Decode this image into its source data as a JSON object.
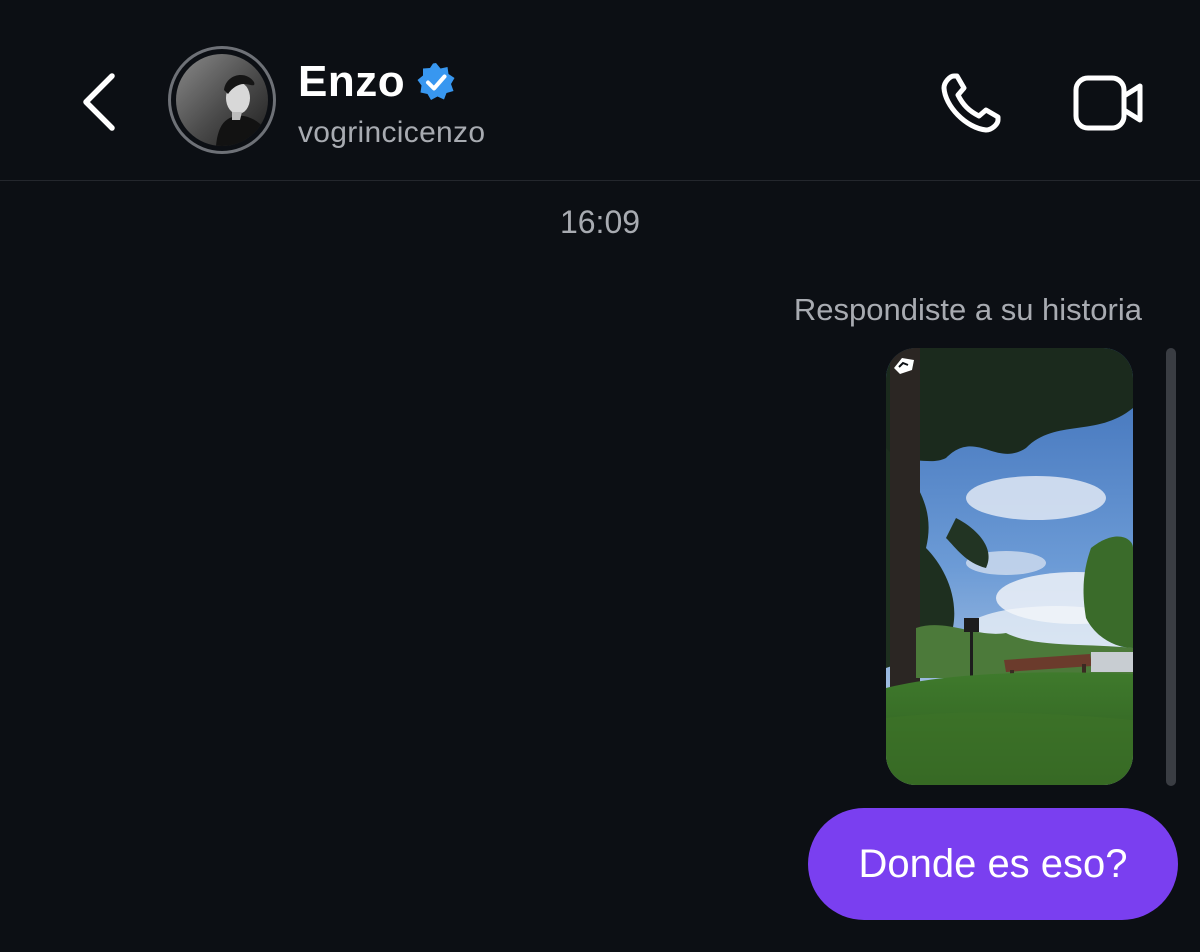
{
  "header": {
    "name": "Enzo",
    "username": "vogrincicenzo",
    "verified": true,
    "icons": {
      "back": "chevron-left-icon",
      "verified": "verified-badge-icon",
      "call": "phone-icon",
      "video": "video-camera-icon"
    }
  },
  "chat": {
    "timestamp": "16:09",
    "story_reply_note": "Respondiste a su historia",
    "story_badge_icon": "story-reply-icon",
    "messages": [
      {
        "sender": "me",
        "text": "Donde es eso?"
      }
    ]
  },
  "colors": {
    "background": "#0c0f14",
    "bubble": "#7a3ff0",
    "verified": "#3897f0",
    "secondary_text": "#a8abb1"
  }
}
